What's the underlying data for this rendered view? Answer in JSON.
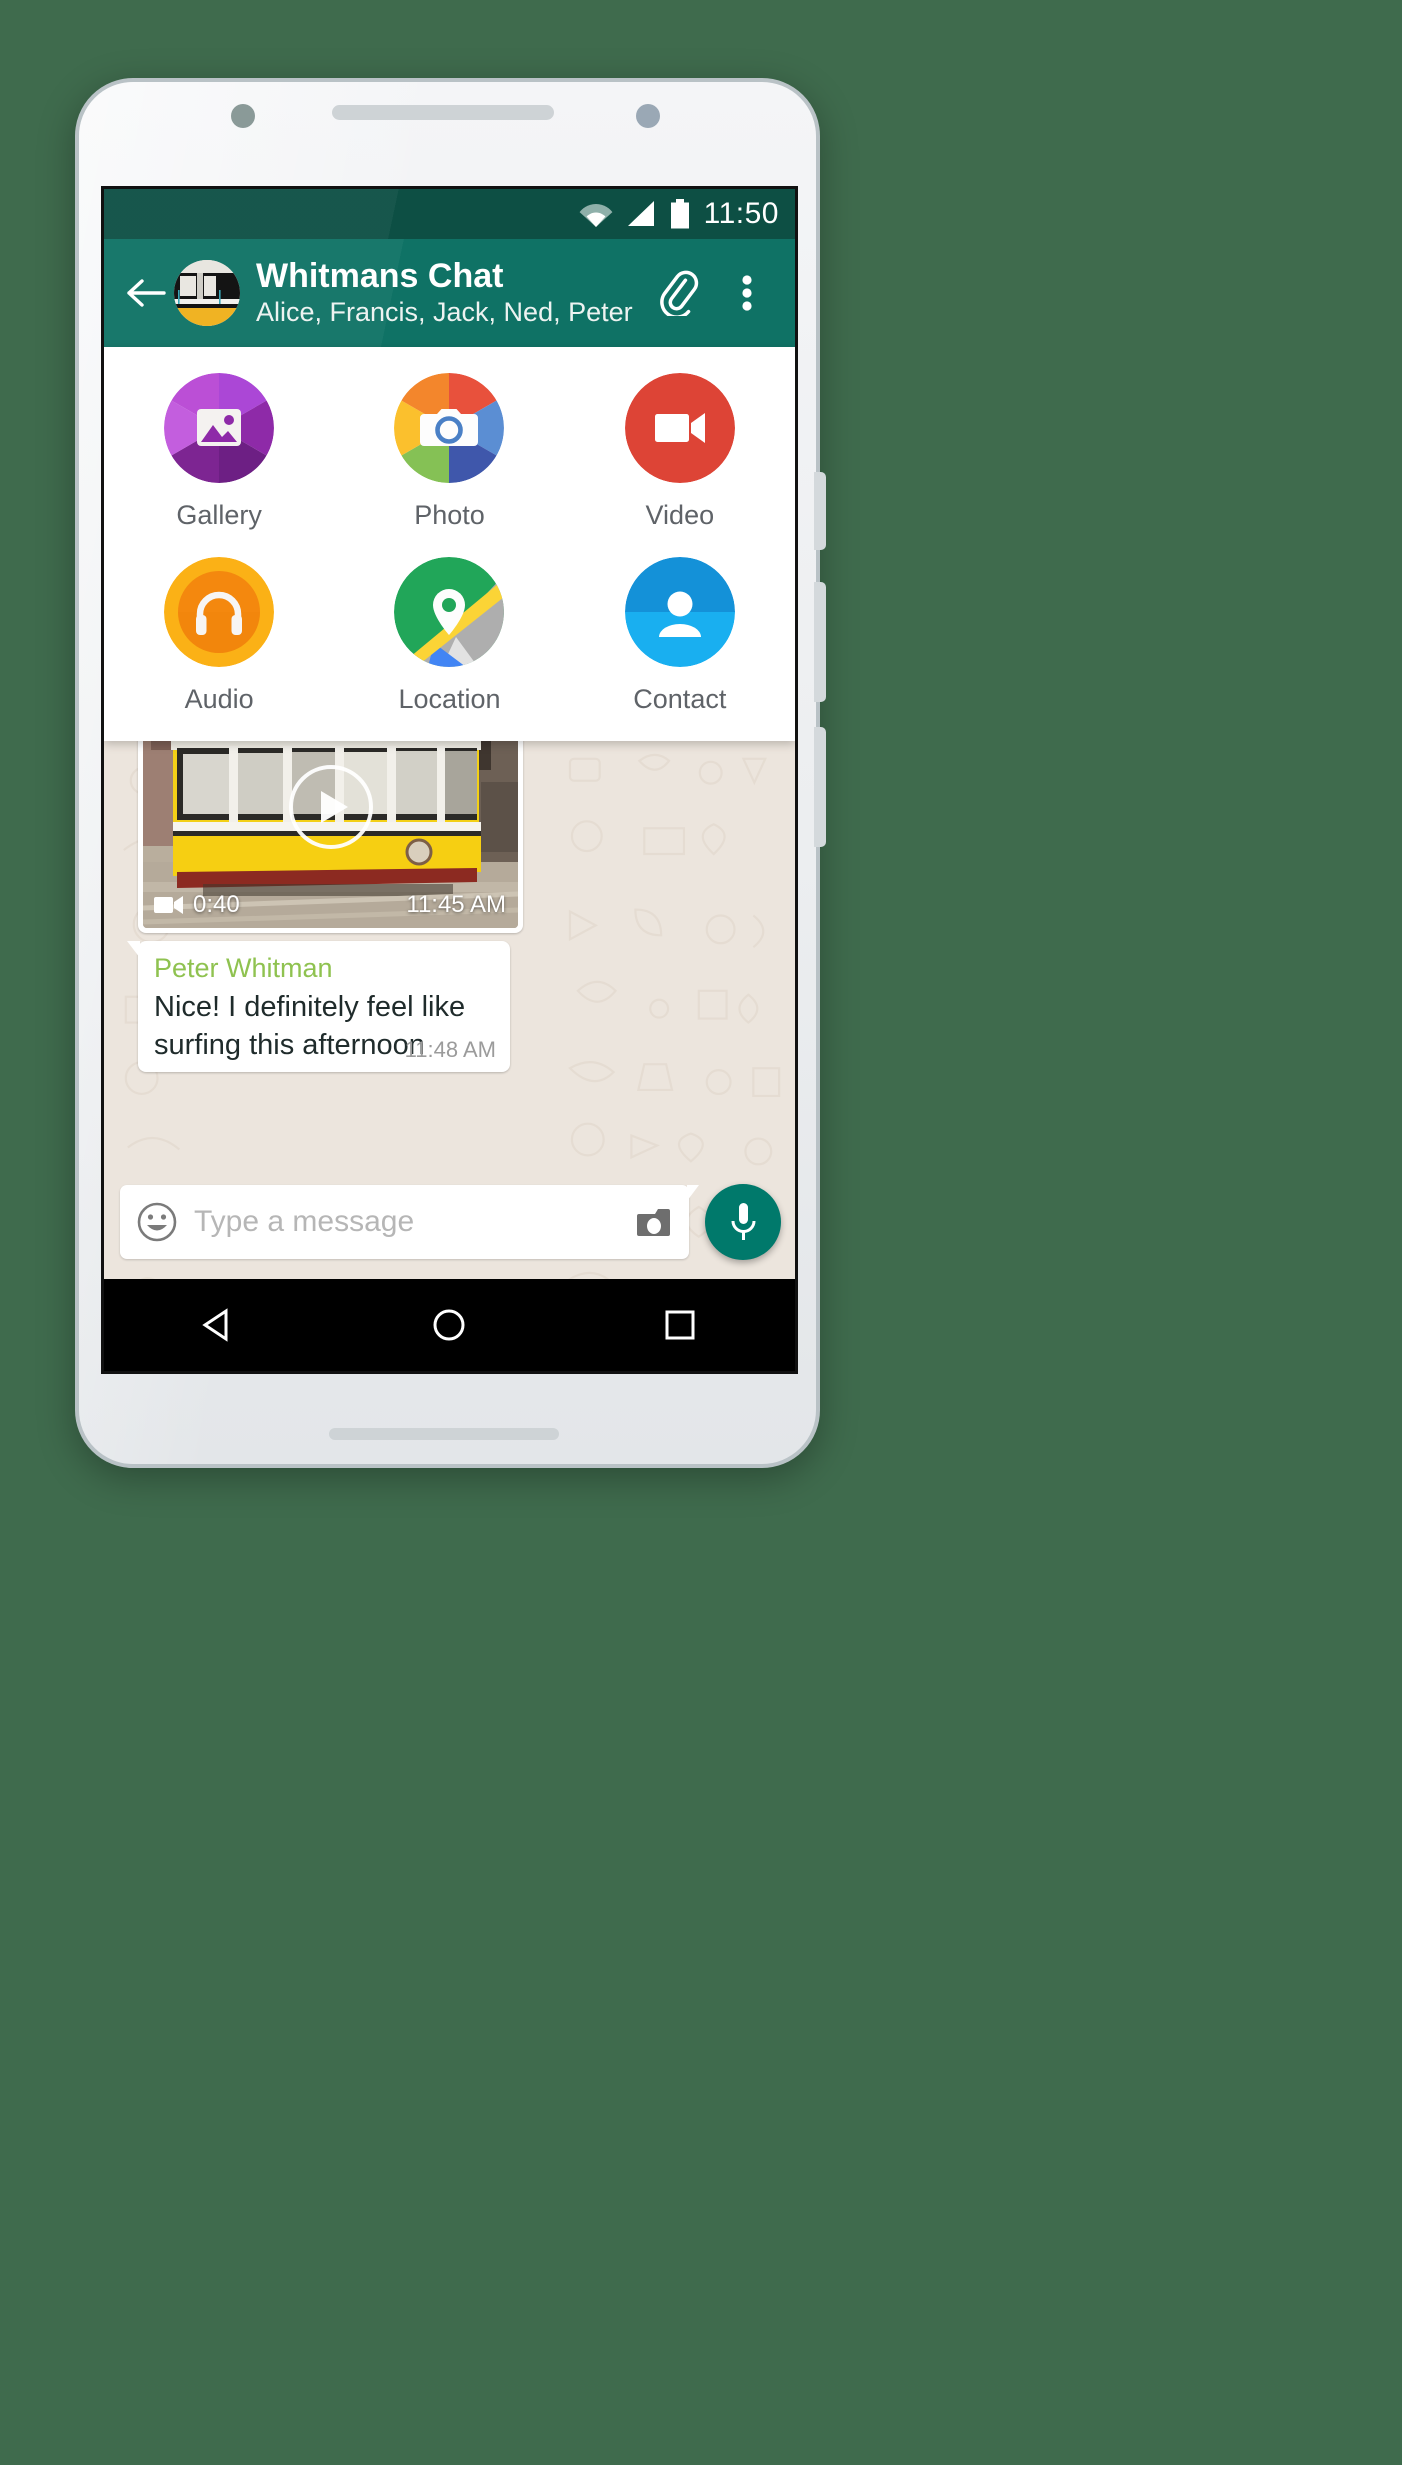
{
  "statusbar": {
    "time": "11:50",
    "icons": [
      "wifi-icon",
      "signal-icon",
      "battery-icon"
    ],
    "bg": "#0d4f44"
  },
  "appbar": {
    "bg": "#0f7265",
    "back_label": "back-arrow-icon",
    "avatar_label": "group-avatar",
    "title": "Whitmans Chat",
    "subtitle": "Alice, Francis, Jack, Ned, Peter",
    "attach_label": "attach-icon",
    "menu_label": "overflow-menu-icon"
  },
  "attachment_panel": {
    "items": [
      {
        "label": "Gallery",
        "icon": "gallery-icon",
        "color": "#9c27b0"
      },
      {
        "label": "Photo",
        "icon": "camera-icon",
        "color": "#f4a124"
      },
      {
        "label": "Video",
        "icon": "video-icon",
        "color": "#dd4436"
      },
      {
        "label": "Audio",
        "icon": "headphones-icon",
        "color": "#f5a623"
      },
      {
        "label": "Location",
        "icon": "location-icon",
        "color": "#21a659"
      },
      {
        "label": "Contact",
        "icon": "contact-icon",
        "color": "#139ae3"
      }
    ]
  },
  "chat": {
    "wallpaper": "#ece5dd",
    "messages": [
      {
        "type": "video",
        "duration": "0:40",
        "time": "11:45 AM",
        "play_label": "play-button-icon",
        "thumb_label": "yellow-tram-video-thumbnail"
      },
      {
        "type": "text",
        "sender": "Peter Whitman",
        "sender_color": "#8fc250",
        "text": "Nice! I definitely feel like surfing this afternoon",
        "time": "11:48 AM"
      }
    ]
  },
  "composer": {
    "emoji_label": "emoji-icon",
    "placeholder": "Type a message",
    "camera_label": "camera-icon",
    "mic_label": "microphone-icon",
    "mic_color": "#00796b"
  },
  "navbar": {
    "back_label": "nav-back-icon",
    "home_label": "nav-home-icon",
    "recents_label": "nav-recents-icon"
  }
}
